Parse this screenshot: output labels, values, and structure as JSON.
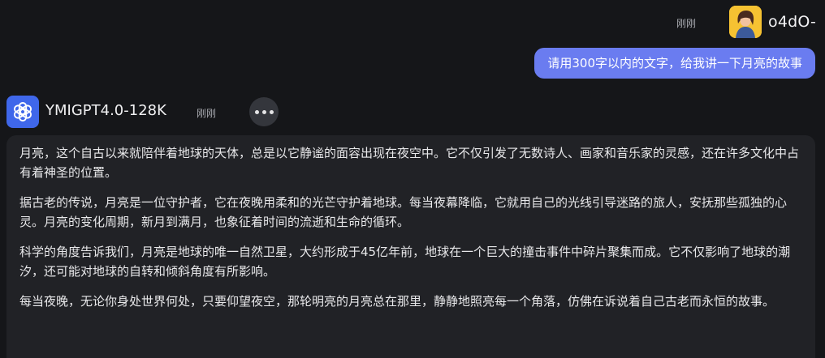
{
  "user": {
    "name": "o4dO-",
    "time": "刚刚",
    "avatar_icon": "user-avatar-illustration",
    "message": "请用300字以内的文字，给我讲一下月亮的故事"
  },
  "assistant": {
    "name": "YMIGPT4.0-128K",
    "time": "刚刚",
    "avatar_icon": "openai-logo-icon",
    "more_icon": "more-dots-icon",
    "paragraphs": [
      "月亮，这个自古以来就陪伴着地球的天体，总是以它静谧的面容出现在夜空中。它不仅引发了无数诗人、画家和音乐家的灵感，还在许多文化中占有着神圣的位置。",
      "据古老的传说，月亮是一位守护者，它在夜晚用柔和的光芒守护着地球。每当夜幕降临，它就用自己的光线引导迷路的旅人，安抚那些孤独的心灵。月亮的变化周期，新月到满月，也象征着时间的流逝和生命的循环。",
      "科学的角度告诉我们，月亮是地球的唯一自然卫星，大约形成于45亿年前，地球在一个巨大的撞击事件中碎片聚集而成。它不仅影响了地球的潮汐，还可能对地球的自转和倾斜角度有所影响。",
      "每当夜晚，无论你身处世界何处，只要仰望夜空，那轮明亮的月亮总在那里，静静地照亮每一个角落，仿佛在诉说着自己古老而永恒的故事。"
    ]
  },
  "colors": {
    "background": "#151619",
    "user_bubble": "#6a7cf0",
    "assistant_bubble": "#212226",
    "assistant_avatar": "#3f67ea",
    "user_avatar": "#f6c232"
  }
}
